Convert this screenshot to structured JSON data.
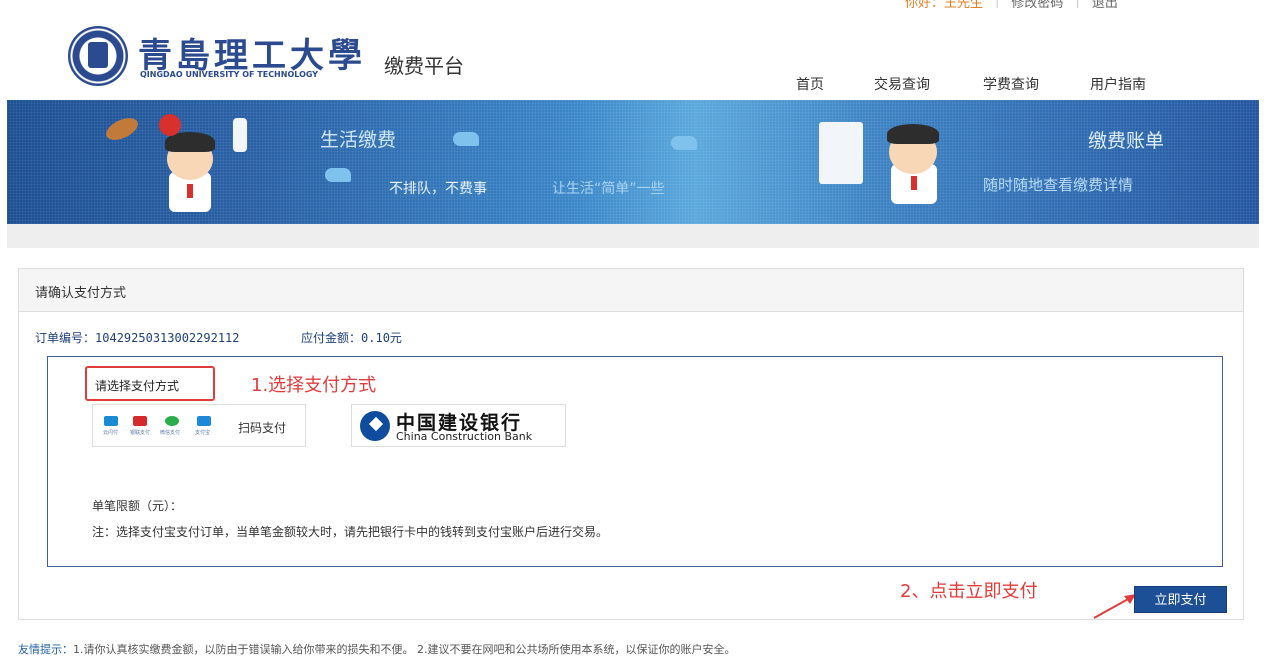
{
  "topbar": {
    "greeting": "你好：王先生",
    "change_password": "修改密码",
    "logout": "退出"
  },
  "header": {
    "university_cn": "青島理工大學",
    "university_en": "QINGDAO UNIVERSITY OF TECHNOLOGY",
    "platform_name": "缴费平台",
    "nav": [
      {
        "label": "首页"
      },
      {
        "label": "交易查询"
      },
      {
        "label": "学费查询"
      },
      {
        "label": "用户指南"
      }
    ]
  },
  "banner": {
    "life_payment": "生活缴费",
    "slogan_1": "不排队，不费事",
    "slogan_2": "让生活“简单”一些",
    "bill_title": "缴费账单",
    "bill_sub": "随时随地查看缴费详情"
  },
  "panel": {
    "title": "请确认支付方式",
    "order_no_label": "订单编号：",
    "order_no": "10429250313002292112",
    "amount_label": "应付金额：",
    "amount": "0.10元",
    "choose_label": "请选择支付方式",
    "annotation_1": "1.选择支付方式",
    "pay_icons": [
      {
        "name": "云闪付",
        "color": "#1a8ad4"
      },
      {
        "name": "银联支付",
        "color": "#d6292d"
      },
      {
        "name": "微信支付",
        "color": "#2aae4a"
      },
      {
        "name": "支付宝",
        "color": "#1e88d8"
      }
    ],
    "scan_pay": "扫码支付",
    "bank_cn": "中国建设银行",
    "bank_en": "China Construction Bank",
    "limit_text": "单笔限额（元）：",
    "note_text": "注：选择支付宝支付订单，当单笔金额较大时，请先把银行卡中的钱转到支付宝账户后进行交易。",
    "annotation_2": "2、点击立即支付",
    "pay_button": "立即支付"
  },
  "tips": {
    "label": "友情提示：",
    "text": "1.请你认真核实缴费金额，以防由于错误输入给你带来的损失和不便。   2.建议不要在网吧和公共场所使用本系统，以保证你的账户安全。"
  }
}
